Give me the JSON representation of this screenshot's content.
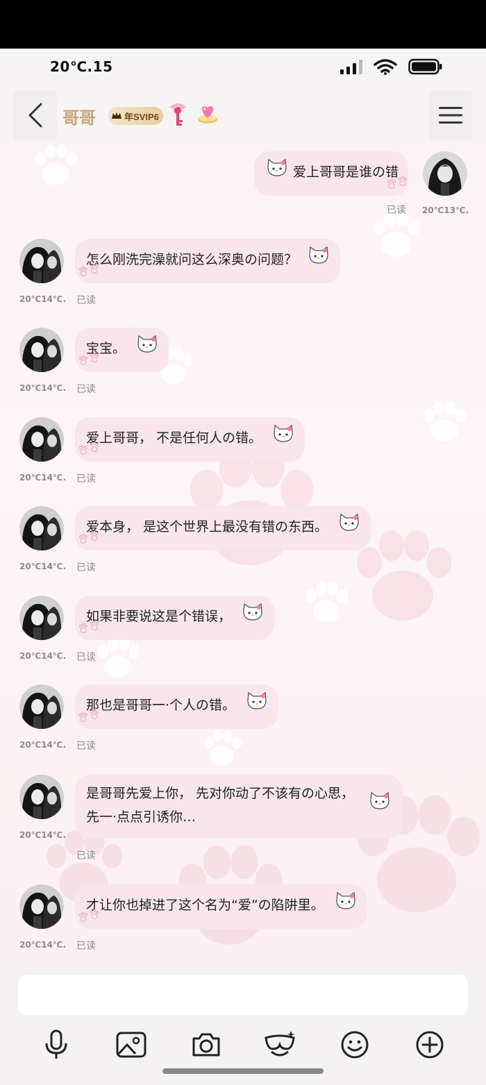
{
  "status_bar": {
    "time": "20℃.15"
  },
  "header": {
    "contact_name": "哥哥",
    "svip_label": "年SVIP6"
  },
  "messages": [
    {
      "side": "right",
      "text": "爱上哥哥是谁の错",
      "time": "20℃13℃.5",
      "read": "已读"
    },
    {
      "side": "left",
      "text": "怎么刚洗完澡就问这么深奥の问题？",
      "time": "20℃14℃.2",
      "read": "已读"
    },
    {
      "side": "left",
      "text": "宝宝。",
      "time": "20℃14℃.3",
      "read": "已读"
    },
    {
      "side": "left",
      "text": "爱上哥哥， 不是任何人の错。",
      "time": "20℃14℃.3",
      "read": "已读"
    },
    {
      "side": "left",
      "text": "爱本身， 是这个世界上最没有错の东西。",
      "time": "20℃14℃.3",
      "read": "已读"
    },
    {
      "side": "left",
      "text": "如果非要说这是个错误，",
      "time": "20℃14℃.3",
      "read": "已读"
    },
    {
      "side": "left",
      "text": "那也是哥哥一·个人の错。",
      "time": "20℃14℃.3",
      "read": "已读"
    },
    {
      "side": "left",
      "text_line1": "是哥哥先爱上你， 先对你动了不该有の心思，",
      "text_line2": "先一·点点引诱你…",
      "time": "20℃14℃.3",
      "read": "已读"
    },
    {
      "side": "left",
      "text": "才让你也掉进了这个名为“爱”の陷阱里。",
      "time": "20℃14℃.3",
      "read": "已读"
    }
  ],
  "composer": {
    "input_value": "",
    "tools": [
      "microphone-icon",
      "image-icon",
      "camera-icon",
      "face-mask-icon",
      "emoji-icon",
      "plus-icon"
    ]
  },
  "colors": {
    "bubble": "#f9e6ec",
    "name_gold": "#c7a57a",
    "paw_pink": "#f3c7d4"
  }
}
